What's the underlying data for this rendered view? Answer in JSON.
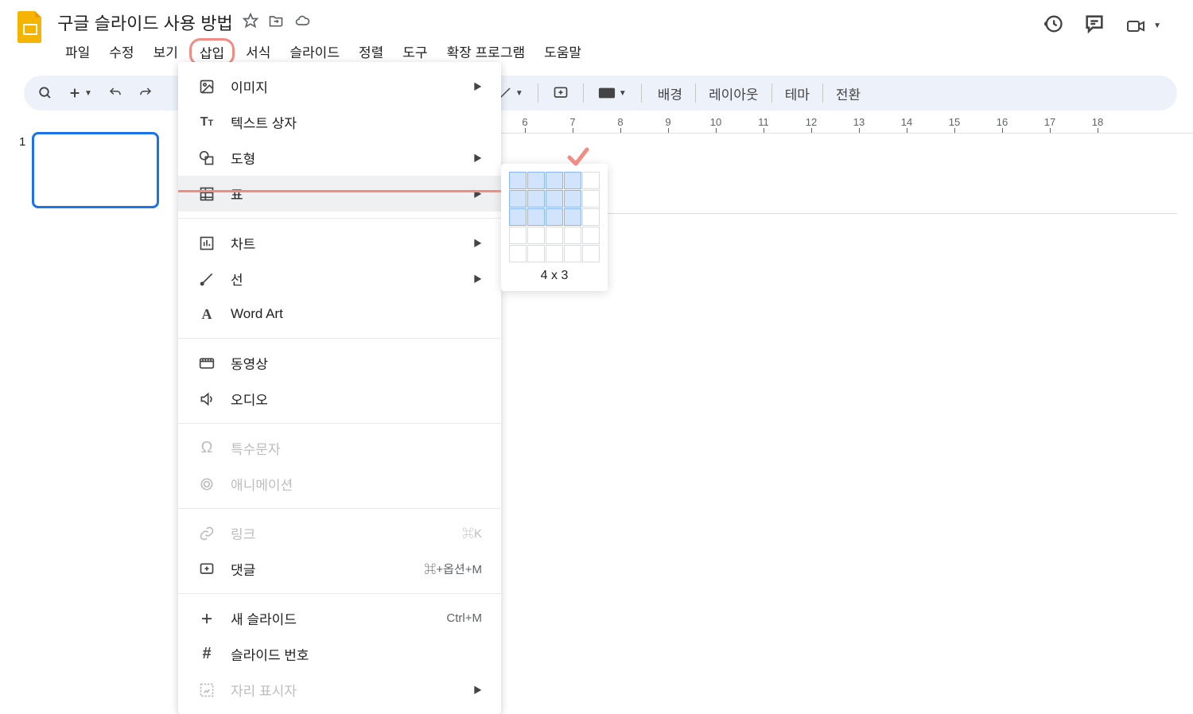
{
  "doc": {
    "title": "구글 슬라이드 사용 방법"
  },
  "menubar": [
    "파일",
    "수정",
    "보기",
    "삽입",
    "서식",
    "슬라이드",
    "정렬",
    "도구",
    "확장 프로그램",
    "도움말"
  ],
  "menubar_highlight_index": 3,
  "toolbar": {
    "buttons_right": [
      "배경",
      "레이아웃",
      "테마",
      "전환"
    ]
  },
  "insert_menu": {
    "items": [
      {
        "icon": "image-icon",
        "label": "이미지",
        "arrow": true
      },
      {
        "icon": "text-box-icon",
        "label": "텍스트 상자"
      },
      {
        "icon": "shape-icon",
        "label": "도형",
        "arrow": true
      },
      {
        "icon": "table-icon",
        "label": "표",
        "arrow": true,
        "hover": true
      },
      {
        "sep": true
      },
      {
        "icon": "chart-icon",
        "label": "차트",
        "arrow": true
      },
      {
        "icon": "line-icon",
        "label": "선",
        "arrow": true
      },
      {
        "icon": "word-art-icon",
        "label": "Word Art"
      },
      {
        "sep": true
      },
      {
        "icon": "video-icon",
        "label": "동영상"
      },
      {
        "icon": "audio-icon",
        "label": "오디오"
      },
      {
        "sep": true
      },
      {
        "icon": "special-char-icon",
        "label": "특수문자",
        "disabled": true
      },
      {
        "icon": "animation-icon",
        "label": "애니메이션",
        "disabled": true
      },
      {
        "sep": true
      },
      {
        "icon": "link-icon",
        "label": "링크",
        "shortcut": "⌘K",
        "disabled": true
      },
      {
        "icon": "comment-icon",
        "label": "댓글",
        "shortcut": "⌘+옵션+M"
      },
      {
        "sep": true
      },
      {
        "icon": "plus-icon",
        "label": "새 슬라이드",
        "shortcut": "Ctrl+M"
      },
      {
        "icon": "hash-icon",
        "label": "슬라이드 번호"
      },
      {
        "icon": "placeholder-icon",
        "label": "자리 표시자",
        "arrow": true,
        "disabled": true
      }
    ]
  },
  "table_submenu": {
    "cols": 4,
    "rows": 3,
    "label": "4 x 3"
  },
  "ruler_ticks": [
    "6",
    "7",
    "8",
    "9",
    "10",
    "11",
    "12",
    "13",
    "14",
    "15",
    "16",
    "17",
    "18"
  ],
  "slide": {
    "number": "1"
  }
}
